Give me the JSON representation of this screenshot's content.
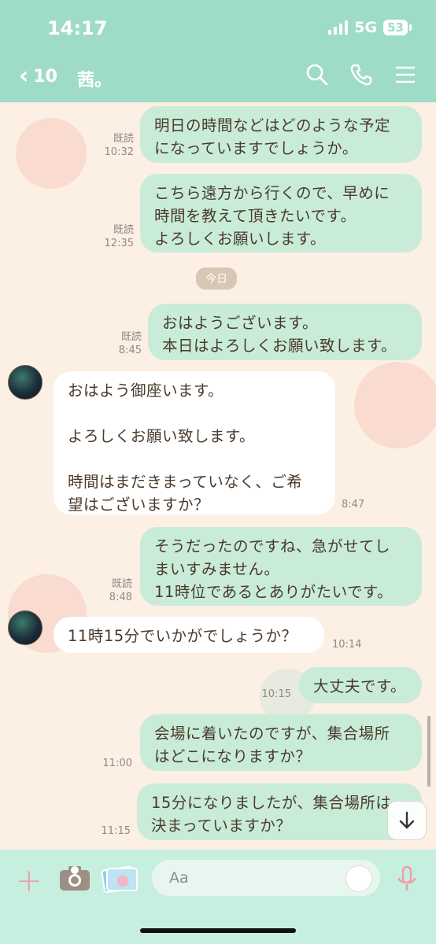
{
  "status": {
    "time": "14:17",
    "network": "5G",
    "battery": "53"
  },
  "header": {
    "back_count": "10",
    "title": "茜。"
  },
  "messages": [
    {
      "text": "明日の時間などはどのような予定\nになっていますでしょうか。",
      "read": "既読",
      "time": "10:32"
    },
    {
      "text": "こちら遠方から行くので、早めに\n時間を教えて頂きたいです。\nよろしくお願いします。",
      "read": "既読",
      "time": "12:35"
    },
    {
      "text": "おはようございます。\n本日はよろしくお願い致します。",
      "read": "既読",
      "time": "8:45"
    },
    {
      "text": "おはよう御座います。\n\nよろしくお願い致します。\n\n時間はまだきまっていなく、ご希\n望はございますか？",
      "time": "8:47"
    },
    {
      "text": "そうだったのですね、急がせてし\nまいすみません。\n11時位であるとありがたいです。",
      "read": "既読",
      "time": "8:48"
    },
    {
      "text": "11時15分でいかがでしょうか？",
      "time": "10:14"
    },
    {
      "text": "大丈夫です。",
      "time": "10:15"
    },
    {
      "text": "会場に着いたのですが、集合場所\nはどこになりますか？",
      "time": "11:00"
    },
    {
      "text": "15分になりましたが、集合場所は\n決まっていますか？",
      "time": "11:15"
    }
  ],
  "date_divider": "今日",
  "input": {
    "placeholder": "Aa"
  },
  "colors": {
    "header": "#9fdcc8",
    "outgoing": "#c9ecd8",
    "incoming": "#ffffff",
    "background": "#fcefe4"
  }
}
